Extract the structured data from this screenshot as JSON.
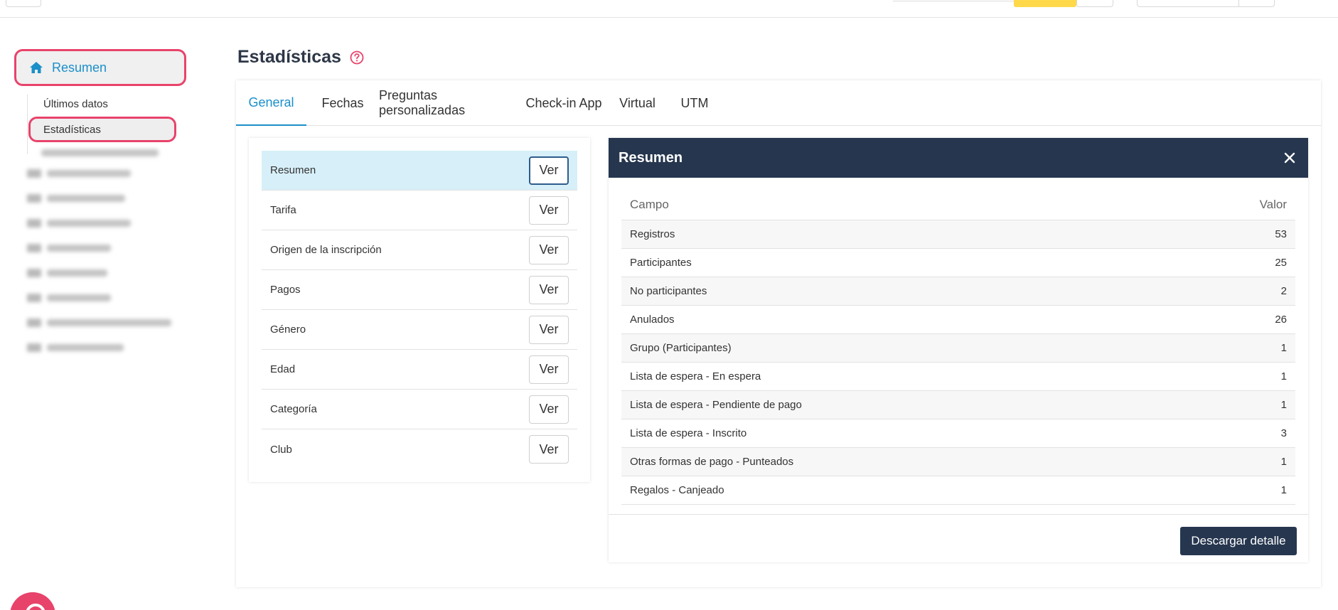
{
  "sidebar": {
    "main_item": "Resumen",
    "sub_items": [
      "Últimos datos",
      "Estadísticas"
    ],
    "blurred_count": 8
  },
  "page": {
    "title": "Estadísticas"
  },
  "tabs": [
    "General",
    "Fechas",
    "Preguntas personalizadas",
    "Check-in App",
    "Virtual",
    "UTM"
  ],
  "stats_list": {
    "button_label": "Ver",
    "items": [
      "Resumen",
      "Tarifa",
      "Origen de la inscripción",
      "Pagos",
      "Género",
      "Edad",
      "Categoría",
      "Club"
    ]
  },
  "detail": {
    "title": "Resumen",
    "columns": {
      "field": "Campo",
      "value": "Valor"
    },
    "rows": [
      {
        "field": "Registros",
        "value": "53"
      },
      {
        "field": "Participantes",
        "value": "25"
      },
      {
        "field": "No participantes",
        "value": "2"
      },
      {
        "field": "Anulados",
        "value": "26"
      },
      {
        "field": "Grupo (Participantes)",
        "value": "1"
      },
      {
        "field": "Lista de espera - En espera",
        "value": "1"
      },
      {
        "field": "Lista de espera - Pendiente de pago",
        "value": "1"
      },
      {
        "field": "Lista de espera - Inscrito",
        "value": "3"
      },
      {
        "field": "Otras formas de pago - Punteados",
        "value": "1"
      },
      {
        "field": "Regalos - Canjeado",
        "value": "1"
      }
    ],
    "download_label": "Descargar detalle"
  },
  "colors": {
    "accent": "#1a8fc9",
    "highlight": "#e8436b",
    "header_dark": "#26364f",
    "active_row": "#d7eff8"
  }
}
